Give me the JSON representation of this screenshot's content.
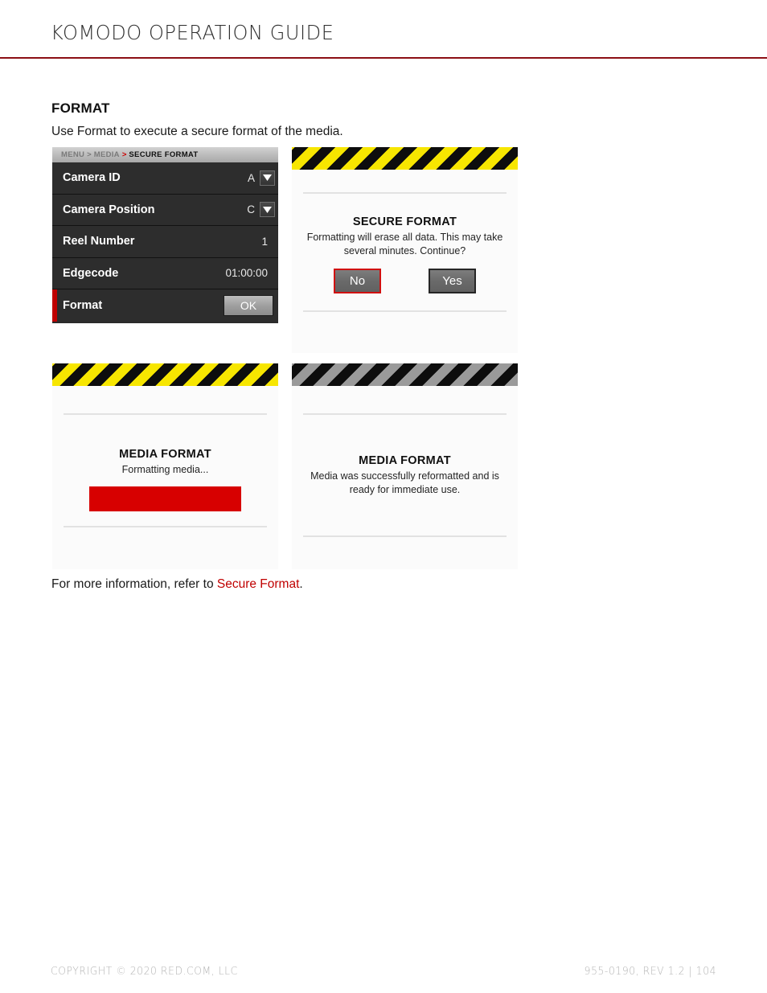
{
  "header": {
    "title": "KOMODO OPERATION GUIDE",
    "rule_color": "#8c0f14"
  },
  "section": {
    "title": "FORMAT",
    "intro": "Use Format to execute a secure format of the media."
  },
  "menu_panel": {
    "breadcrumb": {
      "root": "MENU",
      "sep1": ">",
      "parent": "MEDIA",
      "sep2": ">",
      "current": "SECURE FORMAT"
    },
    "rows": [
      {
        "label": "Camera ID",
        "value": "A",
        "control": "dropdown"
      },
      {
        "label": "Camera Position",
        "value": "C",
        "control": "dropdown"
      },
      {
        "label": "Reel Number",
        "value": "1",
        "control": "text"
      },
      {
        "label": "Edgecode",
        "value": "01:00:00",
        "control": "text"
      },
      {
        "label": "Format",
        "value": "OK",
        "control": "button",
        "selected": true
      }
    ]
  },
  "dialogs": {
    "confirm": {
      "stripe": "yellow",
      "title": "SECURE FORMAT",
      "message": "Formatting will erase all data. This may take several minutes. Continue?",
      "buttons": {
        "no": "No",
        "yes": "Yes"
      },
      "selected_button": "No",
      "selection_color": "#d01010"
    },
    "progress": {
      "stripe": "yellow",
      "title": "MEDIA FORMAT",
      "message": "Formatting media...",
      "progress_percent": 100,
      "progress_color": "#d70000"
    },
    "success": {
      "stripe": "gray",
      "title": "MEDIA FORMAT",
      "message": "Media was successfully reformatted and is ready for immediate use."
    }
  },
  "caption": {
    "prefix": "For more information, refer to ",
    "link": "Secure Format",
    "suffix": "."
  },
  "footer": {
    "left": "COPYRIGHT © 2020 RED.COM, LLC",
    "right": "955-0190, REV 1.2  |  104"
  }
}
